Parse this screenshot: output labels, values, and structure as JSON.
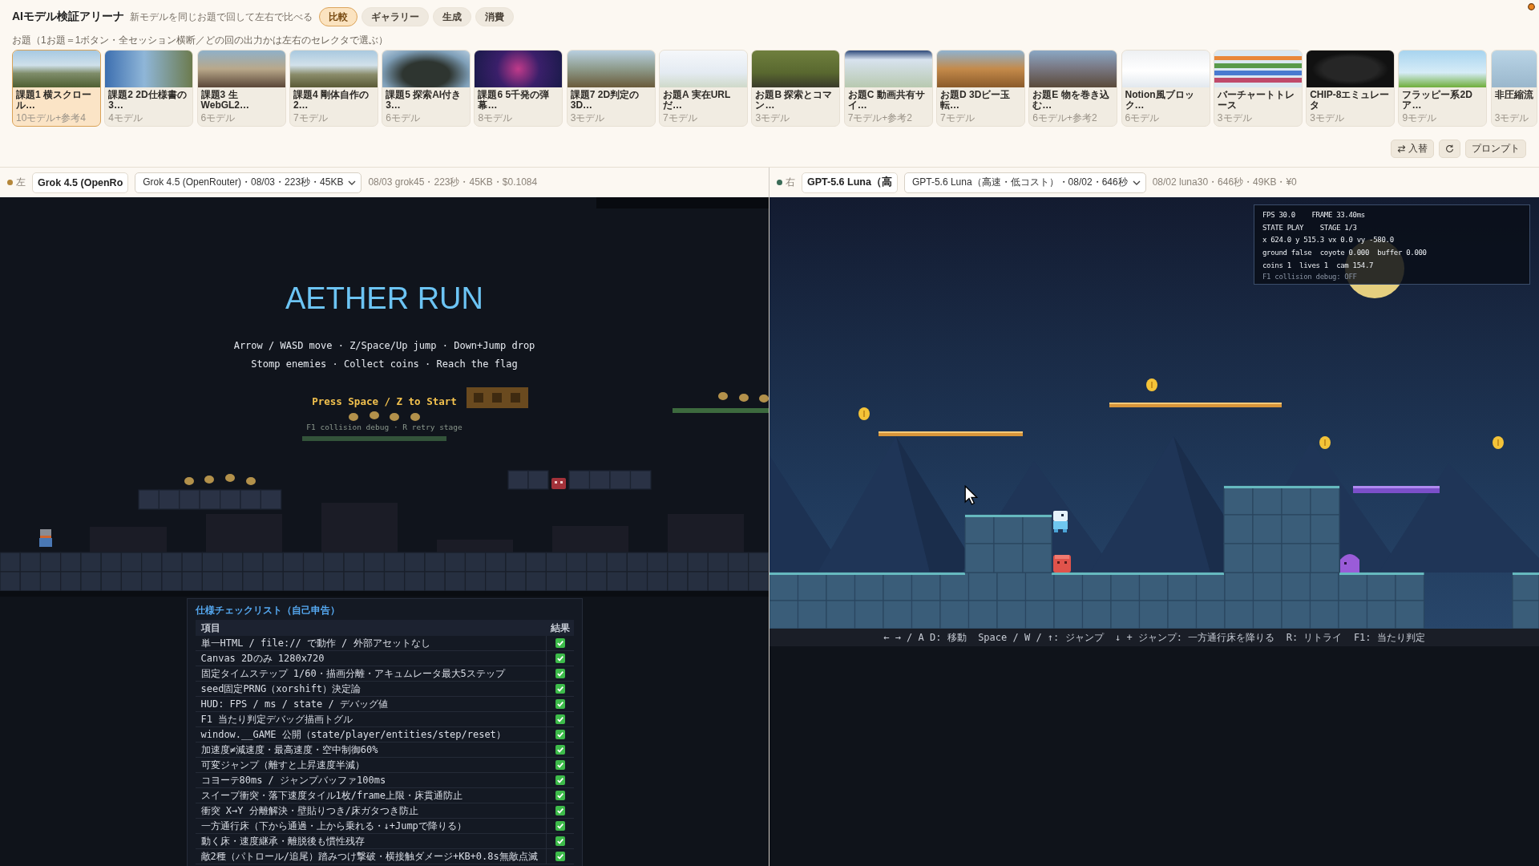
{
  "app": {
    "title": "AIモデル検証アリーナ",
    "subtitle": "新モデルを同じお題で回して左右で比べる",
    "tabs": [
      {
        "label": "比較",
        "selected": true
      },
      {
        "label": "ギャラリー",
        "selected": false
      },
      {
        "label": "生成",
        "selected": false
      },
      {
        "label": "消費",
        "selected": false
      }
    ]
  },
  "topics": {
    "label": "お題（1お題＝1ボタン・全セッション横断／どの回の出力かは左右のセレクタで選ぶ）",
    "items": [
      {
        "title": "課題1 横スクロール…",
        "count": "10モデル+参考4",
        "selected": true
      },
      {
        "title": "課題2 2D仕様書の3…",
        "count": "4モデル",
        "selected": false
      },
      {
        "title": "課題3 生WebGL2…",
        "count": "6モデル",
        "selected": false
      },
      {
        "title": "課題4 剛体自作の2…",
        "count": "7モデル",
        "selected": false
      },
      {
        "title": "課題5 探索AI付き3…",
        "count": "6モデル",
        "selected": false
      },
      {
        "title": "課題6 5千発の弾幕…",
        "count": "8モデル",
        "selected": false
      },
      {
        "title": "課題7 2D判定の3D…",
        "count": "3モデル",
        "selected": false
      },
      {
        "title": "お題A 実在URLだ…",
        "count": "7モデル",
        "selected": false
      },
      {
        "title": "お題B 探索とコマン…",
        "count": "3モデル",
        "selected": false
      },
      {
        "title": "お題C 動画共有サイ…",
        "count": "7モデル+参考2",
        "selected": false
      },
      {
        "title": "お題D 3Dビー玉転…",
        "count": "7モデル",
        "selected": false
      },
      {
        "title": "お題E 物を巻き込む…",
        "count": "6モデル+参考2",
        "selected": false
      },
      {
        "title": "Notion風ブロック…",
        "count": "6モデル",
        "selected": false
      },
      {
        "title": "バーチャートトレース",
        "count": "3モデル",
        "selected": false
      },
      {
        "title": "CHIP-8エミュレータ",
        "count": "3モデル",
        "selected": false
      },
      {
        "title": "フラッピー系2Dア…",
        "count": "9モデル",
        "selected": false
      },
      {
        "title": "非圧縮流",
        "count": "3モデル",
        "selected": false
      }
    ]
  },
  "toolbar": [
    {
      "kind": "swap",
      "label": "入替"
    },
    {
      "kind": "refresh"
    },
    {
      "kind": "prompt",
      "label": "プロンプト"
    }
  ],
  "panels": [
    {
      "side": "左",
      "color": "#b5873a",
      "model_name": "Grok 4.5 (OpenRo",
      "run": "Grok 4.5 (OpenRouter)・08/03・223秒・45KB",
      "meta": "08/03 grok45・223秒・45KB・$0.1084",
      "game": {
        "kind": "title_screen",
        "title": "AETHER RUN",
        "lines": [
          "Arrow / WASD move · Z/Space/Up jump · Down+Jump drop",
          "Stomp enemies · Collect coins · Reach the flag"
        ],
        "prompt": "Press Space / Z to Start",
        "hint": "F1 collision debug · R retry stage"
      },
      "checklist": {
        "title": "仕様チェックリスト（自己申告）",
        "columns": [
          "項目",
          "結果"
        ],
        "rows": [
          {
            "item": "単一HTML / file:// で動作 / 外部アセットなし",
            "ok": true
          },
          {
            "item": "Canvas 2Dのみ 1280x720",
            "ok": true
          },
          {
            "item": "固定タイムステップ 1/60・描画分離・アキュムレータ最大5ステップ",
            "ok": true
          },
          {
            "item": "seed固定PRNG（xorshift）決定論",
            "ok": true
          },
          {
            "item": "HUD: FPS / ms / state / デバッグ値",
            "ok": true
          },
          {
            "item": "F1 当たり判定デバッグ描画トグル",
            "ok": true
          },
          {
            "item": "window.__GAME 公開（state/player/entities/step/reset）",
            "ok": true
          },
          {
            "item": "加速度≠減速度・最高速度・空中制御60%",
            "ok": true
          },
          {
            "item": "可変ジャンプ（離すと上昇速度半減）",
            "ok": true
          },
          {
            "item": "コヨーテ80ms / ジャンプバッファ100ms",
            "ok": true
          },
          {
            "item": "スイープ衝突・落下速度タイル1枚/frame上限・床貫通防止",
            "ok": true
          },
          {
            "item": "衝突 X→Y 分離解決・壁貼りつき/床ガタつき防止",
            "ok": true
          },
          {
            "item": "一方通行床（下から通過・上から乗れる・↓+Jumpで降りる）",
            "ok": true
          },
          {
            "item": "動く床・速度継承・離脱後も慣性残存",
            "ok": true
          },
          {
            "item": "敵2種（パトロール/追尾）踏みつけ撃破・横接触ダメージ+KB+0.8s無敵点滅",
            "ok": true
          }
        ]
      }
    },
    {
      "side": "右",
      "color": "#3a6b57",
      "model_name": "GPT-5.6 Luna（高",
      "run": "GPT-5.6 Luna（高速・低コスト）・08/02・646秒",
      "meta": "08/02 luna30・646秒・49KB・¥0",
      "game": {
        "kind": "stage",
        "hud": [
          "FPS 30.0    FRAME 33.40ms",
          "STATE PLAY    STAGE 1/3",
          "x 624.0 y 515.3 vx 0.0 vy -580.0",
          "ground false  coyote 0.000  buffer 0.000",
          "coins 1  lives 1  cam 154.7"
        ],
        "hud_note": "F1 collision debug: OFF",
        "controls": "← → / A D: 移動  Space / W / ↑: ジャンプ  ↓ + ジャンプ: 一方通行床を降りる  R: リトライ  F1: 当たり判定"
      }
    }
  ]
}
